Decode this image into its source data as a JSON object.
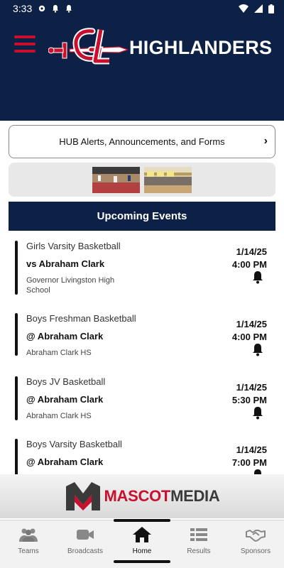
{
  "status_bar": {
    "time": "3:33"
  },
  "header": {
    "title": "HIGHLANDERS"
  },
  "alerts": {
    "label": "HUB Alerts, Announcements, and Forms",
    "chevron": "›"
  },
  "events_section": {
    "title": "Upcoming Events"
  },
  "events": [
    {
      "sport": "Girls Varsity Basketball",
      "opponent": "vs Abraham Clark",
      "location": "Governor Livingston High School",
      "date": "1/14/25",
      "time": "4:00 PM"
    },
    {
      "sport": "Boys Freshman Basketball",
      "opponent": "@ Abraham Clark",
      "location": "Abraham Clark HS",
      "date": "1/14/25",
      "time": "4:00 PM"
    },
    {
      "sport": "Boys JV Basketball",
      "opponent": "@ Abraham Clark",
      "location": "Abraham Clark HS",
      "date": "1/14/25",
      "time": "5:30 PM"
    },
    {
      "sport": "Boys Varsity Basketball",
      "opponent": "@ Abraham Clark",
      "location": "",
      "date": "1/14/25",
      "time": "7:00 PM"
    }
  ],
  "sponsor": {
    "part1": "MASCOT",
    "part2": "MEDIA"
  },
  "nav": {
    "items": [
      {
        "label": "Teams",
        "icon": "teams-icon"
      },
      {
        "label": "Broadcasts",
        "icon": "video-camera-icon"
      },
      {
        "label": "Home",
        "icon": "home-icon"
      },
      {
        "label": "Results",
        "icon": "results-list-icon"
      },
      {
        "label": "Sponsors",
        "icon": "handshake-icon"
      }
    ],
    "active": "Home"
  },
  "colors": {
    "navy": "#0d2146",
    "red": "#c8102e"
  }
}
